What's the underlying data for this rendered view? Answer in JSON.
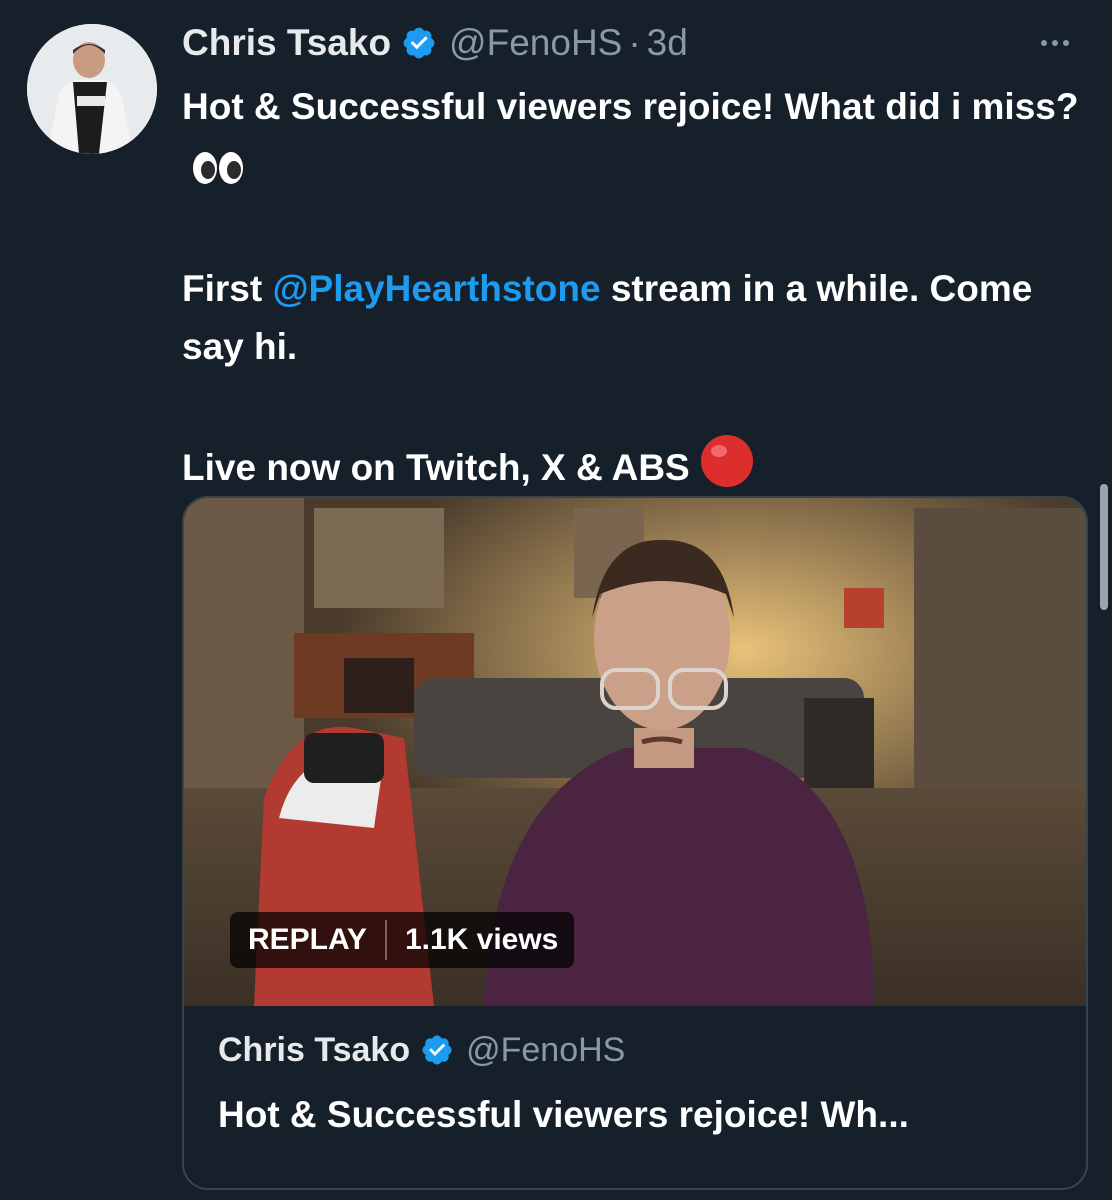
{
  "tweet": {
    "author_name": "Chris Tsako",
    "handle": "@FenoHS",
    "separator": "·",
    "time": "3d",
    "text_line1_part1": "Hot & Successful viewers rejoice! What did i miss?",
    "text_line2_before": "First ",
    "mention": "@PlayHearthstone",
    "text_line2_after": " stream in a while. Come say hi.",
    "text_line3": "Live now on Twitch, X & ABS",
    "more_icon": "more-horizontal-icon",
    "verified_icon": "verified-badge-icon"
  },
  "media": {
    "replay_label": "REPLAY",
    "views_label": "1.1K views"
  },
  "quote": {
    "author_name": "Chris Tsako",
    "handle": "@FenoHS",
    "text": "Hot & Successful viewers rejoice! Wh..."
  },
  "colors": {
    "background": "#15202b",
    "accent": "#1d9bf0",
    "muted": "#8b98a5",
    "border": "#38444d"
  }
}
